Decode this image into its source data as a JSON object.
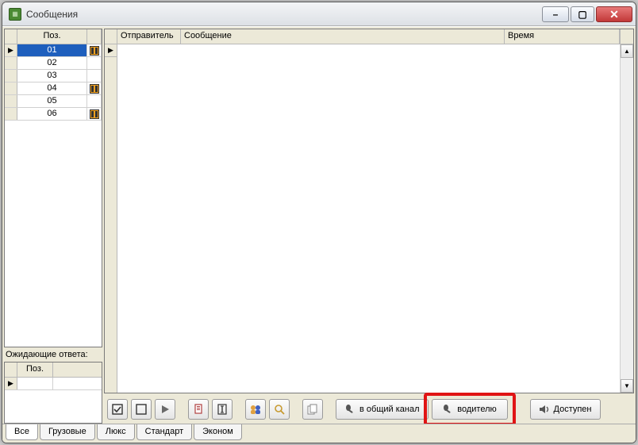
{
  "window": {
    "title": "Сообщения"
  },
  "left": {
    "posHeader": "Поз.",
    "rows": [
      {
        "pos": "01",
        "hasIcon": true,
        "selected": true
      },
      {
        "pos": "02",
        "hasIcon": false,
        "selected": false
      },
      {
        "pos": "03",
        "hasIcon": false,
        "selected": false
      },
      {
        "pos": "04",
        "hasIcon": true,
        "selected": false
      },
      {
        "pos": "05",
        "hasIcon": false,
        "selected": false
      },
      {
        "pos": "06",
        "hasIcon": true,
        "selected": false
      }
    ],
    "waitingLabel": "Ожидающие ответа:",
    "waitingHeader": "Поз."
  },
  "messages": {
    "columns": {
      "sender": "Отправитель",
      "message": "Сообщение",
      "time": "Время"
    }
  },
  "toolbar": {
    "channel_label": "в общий канал",
    "driver_label": "водителю",
    "available_label": "Доступен"
  },
  "tabs": {
    "items": [
      {
        "label": "Все",
        "active": true
      },
      {
        "label": "Грузовые",
        "active": false
      },
      {
        "label": "Люкс",
        "active": false
      },
      {
        "label": "Стандарт",
        "active": false
      },
      {
        "label": "Эконом",
        "active": false
      }
    ]
  },
  "highlight": {
    "target": "driver-button"
  }
}
